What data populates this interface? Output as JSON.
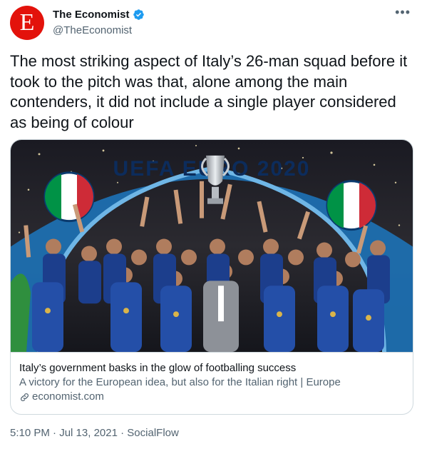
{
  "account": {
    "avatar_letter": "E",
    "name": "The Economist",
    "handle": "@TheEconomist",
    "brand_color": "#e3120b",
    "verified_color": "#1d9bf0"
  },
  "tweet": {
    "text": "The most striking aspect of Italy’s 26-man squad before it took to the pitch was that, alone among the main contenders, it did not include a single player considered as being of colour"
  },
  "card": {
    "image_banner_text": "UEFA EURO 2020",
    "title": "Italy’s government basks in the glow of footballing success",
    "description": "A victory for the European idea, but also for the Italian right | Europe",
    "domain": "economist.com"
  },
  "meta": {
    "time": "5:10 PM",
    "separator": "·",
    "date": "Jul 13, 2021",
    "source": "SocialFlow"
  },
  "icons": {
    "more": "more-options-icon",
    "verified": "verified-badge-icon",
    "link": "link-icon"
  }
}
